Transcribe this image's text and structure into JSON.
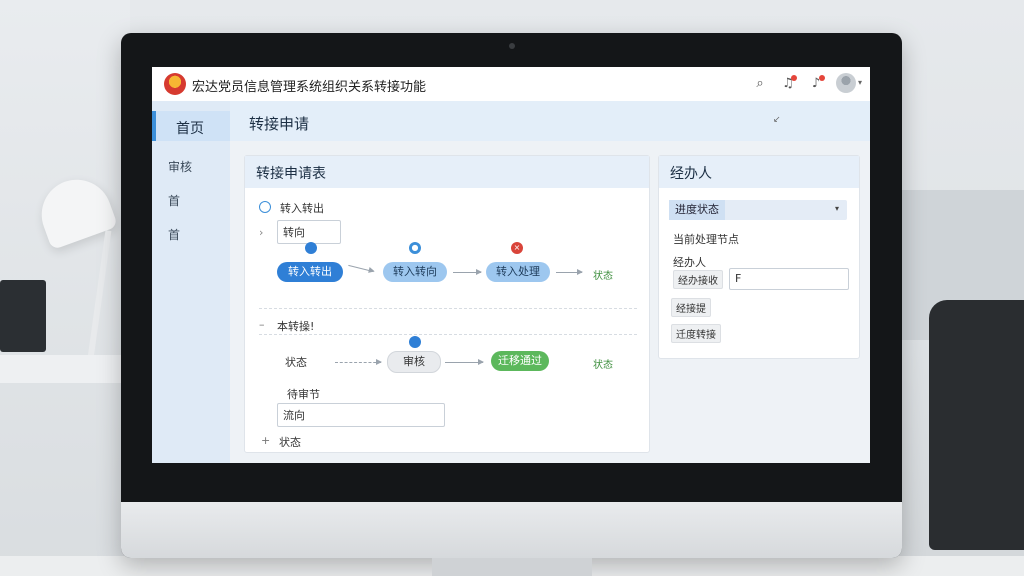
{
  "app": {
    "title": "宏达党员信息管理系统组织关系转接功能"
  },
  "topbar": {
    "icons": [
      "search-icon",
      "bell-icon",
      "notification-icon",
      "avatar"
    ],
    "caret": "▾"
  },
  "sidebar": {
    "items": [
      {
        "label": "首页",
        "active": true
      },
      {
        "label": "审核",
        "active": false
      },
      {
        "label": "首",
        "active": false
      },
      {
        "label": "首",
        "active": false
      }
    ]
  },
  "page": {
    "title": "转接申请",
    "header_tool": "↙"
  },
  "form_card": {
    "title": "转接申请表",
    "radio_label": "转入转出",
    "direction_input": "转向",
    "flow1": {
      "steps": [
        "转入转出",
        "转入转向",
        "转入处理"
      ],
      "end_label": "状态"
    },
    "section2_label": "本转操!",
    "flow2": {
      "start_label": "状态",
      "steps": [
        "审核",
        "迁移通过"
      ],
      "end_label": "状态"
    },
    "subsection_label": "待审节",
    "direction_input2": "流向",
    "footer_label": "状态"
  },
  "handler_card": {
    "title": "经办人",
    "status_select": "进度状态",
    "current_node_label": "当前处理节点",
    "handler_label": "经办人",
    "handler_prefix": "经办接收",
    "handler_value": "F",
    "tag1": "经接提",
    "tag2": "迁度转接"
  },
  "colors": {
    "accent": "#2f7fd6",
    "success": "#5cb85c",
    "danger": "#d9443a"
  }
}
